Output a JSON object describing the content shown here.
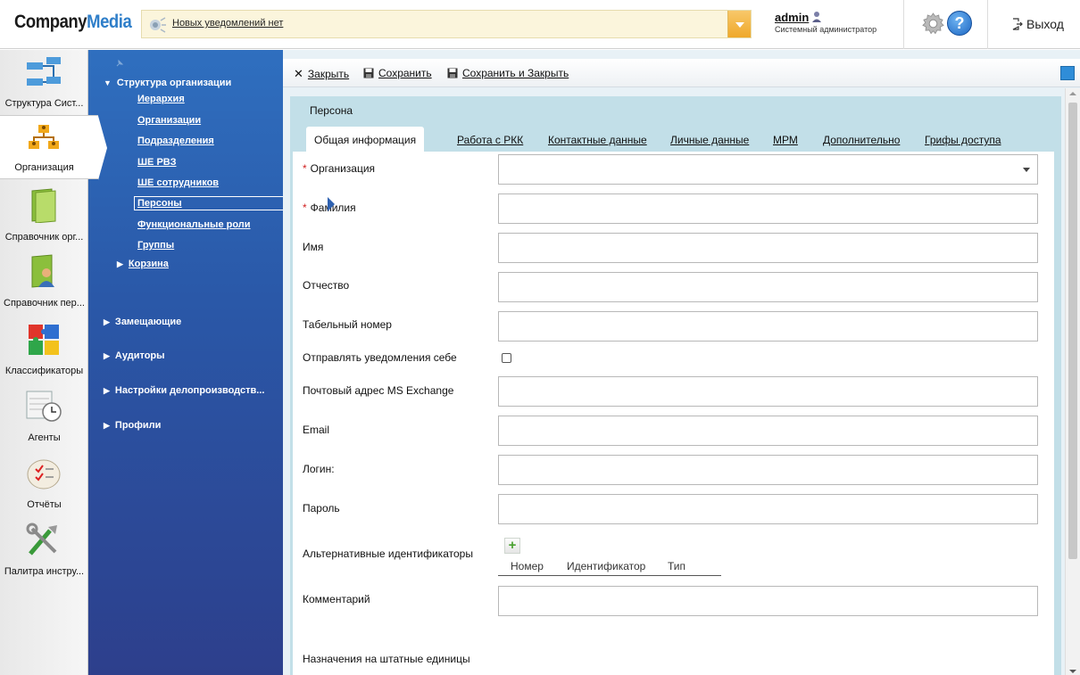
{
  "header": {
    "logo_part1": "Company",
    "logo_part2": "Media",
    "notification_text": "Новых уведомлений нет",
    "user_name": "admin",
    "user_role": "Системный администратор",
    "help_label": "?",
    "logout_label": "Выход"
  },
  "iconbar": {
    "items": [
      {
        "label": "Структура Сист...",
        "icon": "structure-icon"
      },
      {
        "label": "Организация",
        "icon": "organization-icon"
      },
      {
        "label": "Справочник орг...",
        "icon": "folder-icon"
      },
      {
        "label": "Справочник пер...",
        "icon": "person-folder-icon"
      },
      {
        "label": "Классификаторы",
        "icon": "puzzle-icon"
      },
      {
        "label": "Агенты",
        "icon": "clock-calendar-icon"
      },
      {
        "label": "Отчёты",
        "icon": "report-icon"
      },
      {
        "label": "Палитра инстру...",
        "icon": "tools-icon"
      }
    ],
    "active_index": 1
  },
  "navtree": {
    "root": "Структура организации",
    "children": [
      "Иерархия",
      "Организации",
      "Подразделения",
      "ШЕ РВЗ",
      "ШЕ сотрудников",
      "Персоны",
      "Функциональные роли",
      "Группы"
    ],
    "basket": "Корзина",
    "sections": [
      "Замещающие",
      "Аудиторы",
      "Настройки делопроизводств...",
      "Профили"
    ]
  },
  "toolbar": {
    "close_label": "Закрыть",
    "save_label": "Сохранить",
    "save_close_label": "Сохранить и Закрыть"
  },
  "form": {
    "title": "Персона",
    "tabs": [
      "Общая информация",
      "Работа с РКК",
      "Контактные данные",
      "Личные данные",
      "МРМ",
      "Дополнительно",
      "Грифы доступа"
    ],
    "active_tab": 0,
    "fields": {
      "organization": "Организация",
      "surname": "Фамилия",
      "name": "Имя",
      "patronymic": "Отчество",
      "tab_number": "Табельный номер",
      "notify_self": "Отправлять уведомления себе",
      "exchange": "Почтовый адрес MS Exchange",
      "email": "Email",
      "login": "Логин:",
      "password": "Пароль",
      "alt_ids": "Альтернативные идентификаторы",
      "comment": "Комментарий",
      "assignments": "Назначения на штатные единицы"
    },
    "alt_columns": [
      "Номер",
      "Идентификатор",
      "Тип"
    ],
    "add_label": "+",
    "required_mark": "*"
  }
}
